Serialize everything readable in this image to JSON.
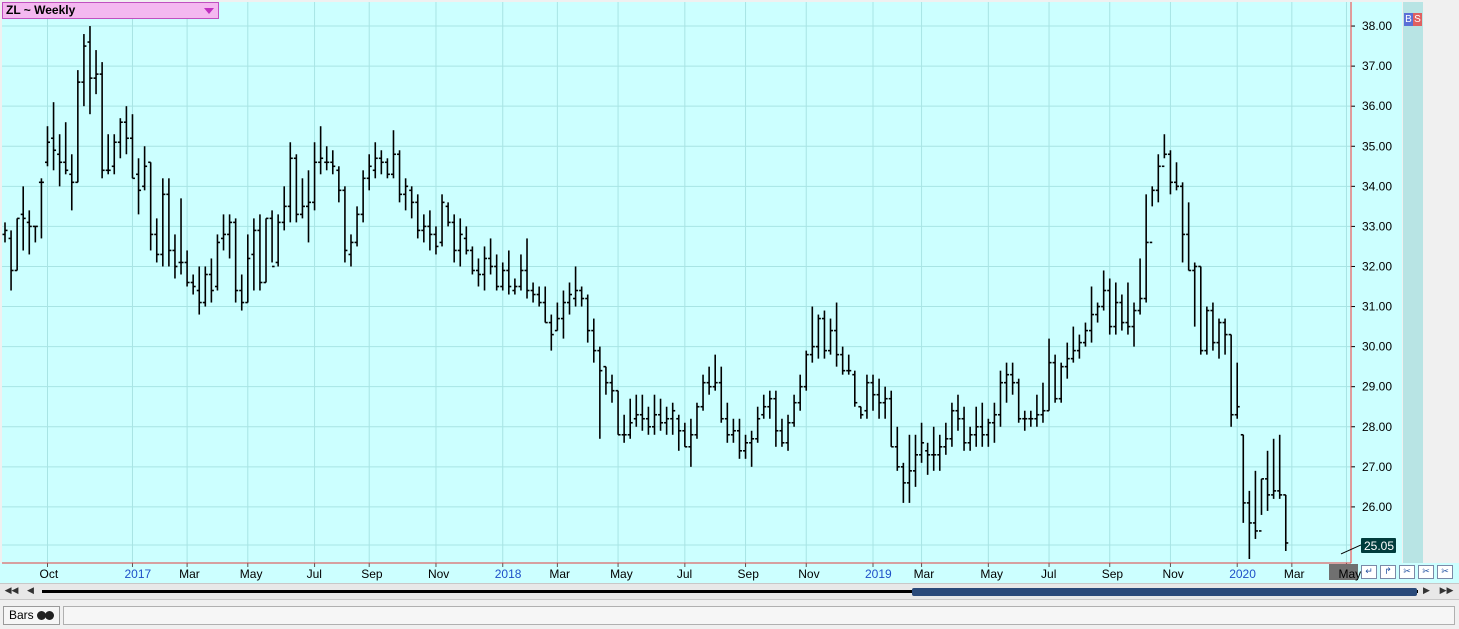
{
  "toolbar": {
    "symbol_label": "ZL ~ Weekly"
  },
  "buy_sell": {
    "buy": "B",
    "sell": "S"
  },
  "bottom": {
    "tab_label": "Bars"
  },
  "colors": {
    "plot_bg": "#ccffff",
    "grid": "#a8e4e4",
    "bar": "#000000",
    "axis_bg": "#ccffff",
    "price_tag": "#003c3c",
    "year_label": "#1e50c8"
  },
  "icons": {
    "scroll_left": "double-left-arrow-icon",
    "scroll_right": "double-right-arrow-icon"
  },
  "chart_data": {
    "type": "ohlc",
    "interval": "Weekly",
    "symbol": "ZL",
    "ylim": [
      24.6,
      38.6
    ],
    "yticks": [
      26.0,
      27.0,
      28.0,
      29.0,
      30.0,
      31.0,
      32.0,
      33.0,
      34.0,
      35.0,
      36.0,
      37.0,
      38.0
    ],
    "last_price": "25.05",
    "x_labels": [
      {
        "label": "Oct",
        "i": 7,
        "year": false
      },
      {
        "label": "2017",
        "i": 21,
        "year": true
      },
      {
        "label": "Mar",
        "i": 30,
        "year": false
      },
      {
        "label": "May",
        "i": 40,
        "year": false
      },
      {
        "label": "Jul",
        "i": 51,
        "year": false
      },
      {
        "label": "Sep",
        "i": 60,
        "year": false
      },
      {
        "label": "Nov",
        "i": 71,
        "year": false
      },
      {
        "label": "2018",
        "i": 82,
        "year": true
      },
      {
        "label": "Mar",
        "i": 91,
        "year": false
      },
      {
        "label": "May",
        "i": 101,
        "year": false
      },
      {
        "label": "Jul",
        "i": 112,
        "year": false
      },
      {
        "label": "Sep",
        "i": 122,
        "year": false
      },
      {
        "label": "Nov",
        "i": 132,
        "year": false
      },
      {
        "label": "2019",
        "i": 143,
        "year": true
      },
      {
        "label": "Mar",
        "i": 151,
        "year": false
      },
      {
        "label": "May",
        "i": 162,
        "year": false
      },
      {
        "label": "Jul",
        "i": 172,
        "year": false
      },
      {
        "label": "Sep",
        "i": 182,
        "year": false
      },
      {
        "label": "Nov",
        "i": 192,
        "year": false
      },
      {
        "label": "2020",
        "i": 203,
        "year": true
      },
      {
        "label": "Mar",
        "i": 212,
        "year": false
      },
      {
        "label": "May",
        "i": 221,
        "year": false
      }
    ],
    "bars": [
      [
        32.8,
        33.1,
        32.6,
        32.9
      ],
      [
        32.7,
        32.9,
        31.4,
        31.9
      ],
      [
        31.9,
        33.2,
        31.9,
        33.2
      ],
      [
        33.3,
        34.0,
        32.4,
        33.2
      ],
      [
        33.1,
        33.4,
        32.3,
        33.0
      ],
      [
        33.0,
        33.0,
        32.6,
        33.0
      ],
      [
        34.1,
        34.2,
        32.7,
        34.1
      ],
      [
        34.6,
        35.5,
        34.5,
        35.1
      ],
      [
        35.2,
        36.1,
        34.4,
        34.9
      ],
      [
        34.8,
        35.3,
        34.0,
        34.6
      ],
      [
        34.6,
        35.6,
        34.3,
        34.4
      ],
      [
        34.3,
        34.8,
        33.4,
        34.1
      ],
      [
        34.1,
        36.9,
        34.1,
        36.6
      ],
      [
        36.6,
        37.8,
        36.0,
        37.5
      ],
      [
        37.6,
        38.0,
        35.8,
        36.7
      ],
      [
        36.7,
        37.4,
        36.3,
        36.8
      ],
      [
        36.8,
        37.1,
        34.2,
        34.4
      ],
      [
        34.4,
        35.3,
        34.3,
        34.4
      ],
      [
        34.5,
        35.3,
        34.3,
        35.1
      ],
      [
        35.1,
        35.7,
        34.7,
        35.6
      ],
      [
        35.6,
        36.0,
        34.8,
        35.2
      ],
      [
        35.2,
        35.8,
        34.2,
        34.2
      ],
      [
        34.3,
        34.7,
        33.3,
        33.9
      ],
      [
        34.0,
        35.0,
        33.9,
        34.5
      ],
      [
        34.6,
        34.6,
        32.4,
        32.8
      ],
      [
        32.8,
        33.2,
        32.1,
        32.3
      ],
      [
        32.3,
        34.2,
        32.0,
        33.8
      ],
      [
        33.8,
        34.2,
        32.0,
        32.4
      ],
      [
        32.4,
        32.8,
        31.7,
        32.0
      ],
      [
        32.1,
        33.7,
        31.8,
        32.1
      ],
      [
        32.1,
        32.4,
        31.5,
        31.6
      ],
      [
        31.6,
        31.8,
        31.3,
        31.5
      ],
      [
        31.4,
        32.0,
        30.8,
        31.1
      ],
      [
        31.1,
        32.0,
        31.0,
        31.8
      ],
      [
        31.8,
        32.2,
        31.1,
        31.4
      ],
      [
        31.5,
        32.8,
        31.4,
        32.6
      ],
      [
        32.7,
        33.3,
        32.4,
        32.8
      ],
      [
        32.8,
        33.3,
        32.2,
        33.1
      ],
      [
        33.1,
        33.2,
        31.1,
        31.4
      ],
      [
        31.4,
        31.8,
        30.9,
        31.1
      ],
      [
        31.1,
        32.8,
        31.1,
        32.2
      ],
      [
        32.3,
        33.2,
        31.4,
        32.9
      ],
      [
        32.9,
        33.3,
        31.4,
        31.6
      ],
      [
        31.6,
        33.2,
        31.6,
        33.2
      ],
      [
        33.2,
        33.4,
        32.1,
        32.0
      ],
      [
        32.1,
        33.3,
        32.0,
        33.1
      ],
      [
        33.1,
        34.0,
        32.9,
        33.5
      ],
      [
        33.5,
        35.1,
        33.1,
        34.7
      ],
      [
        34.7,
        34.8,
        33.1,
        33.3
      ],
      [
        33.3,
        34.2,
        33.2,
        33.5
      ],
      [
        33.5,
        34.4,
        32.6,
        33.6
      ],
      [
        33.6,
        35.1,
        33.4,
        34.6
      ],
      [
        34.6,
        35.5,
        34.3,
        34.7
      ],
      [
        34.6,
        35.0,
        34.4,
        34.6
      ],
      [
        34.6,
        34.9,
        34.3,
        34.5
      ],
      [
        34.4,
        34.5,
        33.6,
        33.9
      ],
      [
        33.9,
        34.0,
        32.1,
        32.4
      ],
      [
        32.3,
        32.8,
        32.0,
        32.6
      ],
      [
        32.6,
        33.5,
        32.5,
        33.3
      ],
      [
        33.3,
        34.4,
        33.1,
        34.2
      ],
      [
        34.2,
        34.8,
        33.9,
        34.5
      ],
      [
        34.4,
        35.1,
        34.2,
        34.7
      ],
      [
        34.7,
        34.9,
        34.3,
        34.6
      ],
      [
        34.6,
        34.7,
        34.2,
        34.3
      ],
      [
        34.3,
        35.4,
        34.2,
        34.8
      ],
      [
        34.8,
        34.9,
        33.6,
        33.8
      ],
      [
        33.8,
        34.2,
        33.4,
        34.0
      ],
      [
        33.9,
        34.0,
        33.2,
        33.6
      ],
      [
        33.6,
        33.8,
        32.7,
        32.9
      ],
      [
        32.9,
        33.3,
        32.6,
        33.0
      ],
      [
        33.0,
        33.4,
        32.4,
        32.8
      ],
      [
        32.8,
        33.0,
        32.3,
        32.5
      ],
      [
        32.6,
        33.8,
        32.5,
        33.6
      ],
      [
        33.5,
        33.6,
        33.0,
        33.1
      ],
      [
        33.1,
        33.3,
        32.1,
        32.4
      ],
      [
        32.4,
        33.2,
        32.0,
        32.8
      ],
      [
        32.7,
        33.0,
        32.3,
        32.4
      ],
      [
        32.4,
        32.5,
        31.8,
        31.9
      ],
      [
        31.9,
        32.2,
        31.5,
        31.8
      ],
      [
        31.8,
        32.5,
        31.4,
        32.2
      ],
      [
        32.2,
        32.7,
        31.8,
        32.0
      ],
      [
        32.0,
        32.3,
        31.4,
        31.5
      ],
      [
        31.5,
        32.1,
        31.4,
        31.9
      ],
      [
        31.9,
        32.4,
        31.3,
        31.5
      ],
      [
        31.4,
        31.7,
        31.3,
        31.5
      ],
      [
        31.5,
        32.3,
        31.4,
        31.9
      ],
      [
        31.9,
        32.7,
        31.2,
        31.4
      ],
      [
        31.4,
        31.6,
        31.1,
        31.3
      ],
      [
        31.3,
        31.5,
        31.0,
        31.1
      ],
      [
        31.1,
        31.5,
        30.6,
        30.6
      ],
      [
        30.6,
        30.8,
        29.9,
        30.3
      ],
      [
        30.4,
        31.1,
        30.4,
        30.7
      ],
      [
        30.7,
        31.4,
        30.2,
        31.1
      ],
      [
        31.1,
        31.6,
        30.8,
        31.3
      ],
      [
        31.2,
        32.0,
        31.0,
        31.4
      ],
      [
        31.4,
        31.5,
        31.0,
        31.2
      ],
      [
        31.2,
        31.3,
        30.1,
        30.4
      ],
      [
        30.4,
        30.7,
        29.6,
        29.9
      ],
      [
        29.9,
        30.0,
        27.7,
        29.4
      ],
      [
        29.5,
        29.5,
        28.8,
        29.1
      ],
      [
        29.1,
        29.3,
        28.6,
        28.9
      ],
      [
        28.9,
        28.9,
        27.8,
        27.8
      ],
      [
        27.8,
        28.3,
        27.6,
        27.8
      ],
      [
        27.8,
        28.7,
        27.7,
        28.1
      ],
      [
        28.2,
        28.8,
        28.0,
        28.3
      ],
      [
        28.3,
        28.8,
        27.9,
        28.2
      ],
      [
        28.2,
        28.5,
        27.8,
        28.0
      ],
      [
        28.0,
        28.8,
        27.8,
        28.3
      ],
      [
        28.3,
        28.7,
        27.9,
        28.1
      ],
      [
        28.1,
        28.5,
        27.8,
        28.2
      ],
      [
        28.2,
        28.6,
        27.8,
        28.4
      ],
      [
        28.2,
        28.3,
        27.4,
        27.9
      ],
      [
        27.9,
        28.1,
        27.5,
        27.5
      ],
      [
        27.5,
        28.2,
        27.0,
        27.8
      ],
      [
        27.8,
        28.6,
        27.7,
        28.5
      ],
      [
        28.5,
        29.3,
        28.4,
        29.1
      ],
      [
        29.1,
        29.5,
        28.8,
        29.0
      ],
      [
        29.0,
        29.8,
        28.9,
        29.1
      ],
      [
        29.1,
        29.5,
        28.1,
        28.2
      ],
      [
        28.2,
        28.6,
        27.6,
        27.8
      ],
      [
        27.8,
        28.2,
        27.6,
        27.9
      ],
      [
        27.9,
        28.2,
        27.2,
        27.4
      ],
      [
        27.4,
        27.8,
        27.2,
        27.6
      ],
      [
        27.6,
        27.9,
        27.0,
        27.7
      ],
      [
        27.7,
        28.5,
        27.6,
        28.2
      ],
      [
        28.3,
        28.8,
        28.2,
        28.5
      ],
      [
        28.5,
        28.9,
        28.2,
        28.7
      ],
      [
        28.7,
        28.9,
        27.5,
        27.9
      ],
      [
        27.9,
        28.2,
        27.5,
        27.6
      ],
      [
        27.6,
        28.3,
        27.4,
        28.1
      ],
      [
        28.1,
        28.8,
        28.0,
        28.6
      ],
      [
        28.6,
        29.3,
        28.4,
        29.0
      ],
      [
        29.0,
        29.9,
        28.9,
        29.8
      ],
      [
        29.8,
        31.0,
        29.6,
        30.0
      ],
      [
        30.0,
        30.8,
        29.7,
        30.7
      ],
      [
        30.7,
        30.9,
        29.7,
        29.9
      ],
      [
        29.9,
        30.7,
        29.8,
        30.4
      ],
      [
        30.4,
        31.1,
        29.5,
        29.8
      ],
      [
        29.8,
        30.0,
        29.3,
        29.4
      ],
      [
        29.4,
        29.8,
        29.3,
        29.4
      ],
      [
        29.3,
        29.4,
        28.5,
        28.6
      ],
      [
        28.5,
        28.5,
        28.2,
        28.3
      ],
      [
        28.4,
        29.3,
        28.2,
        29.1
      ],
      [
        29.1,
        29.3,
        28.4,
        28.8
      ],
      [
        28.8,
        29.2,
        28.2,
        28.6
      ],
      [
        28.6,
        29.0,
        28.2,
        28.7
      ],
      [
        28.7,
        28.9,
        27.5,
        27.5
      ],
      [
        27.5,
        28.0,
        26.9,
        27.0
      ],
      [
        27.0,
        27.1,
        26.1,
        26.6
      ],
      [
        26.6,
        27.8,
        26.1,
        26.9
      ],
      [
        26.9,
        27.8,
        26.5,
        27.3
      ],
      [
        27.3,
        28.1,
        27.1,
        27.6
      ],
      [
        27.4,
        27.6,
        26.8,
        27.3
      ],
      [
        27.3,
        28.0,
        26.9,
        27.3
      ],
      [
        27.3,
        27.8,
        26.9,
        27.5
      ],
      [
        27.5,
        28.1,
        27.3,
        27.7
      ],
      [
        27.7,
        28.6,
        27.5,
        28.4
      ],
      [
        28.4,
        28.8,
        27.9,
        28.2
      ],
      [
        28.2,
        28.5,
        27.4,
        27.6
      ],
      [
        27.6,
        28.0,
        27.4,
        27.8
      ],
      [
        27.8,
        28.5,
        27.5,
        28.0
      ],
      [
        28.0,
        28.6,
        27.5,
        27.8
      ],
      [
        27.8,
        28.2,
        27.5,
        28.1
      ],
      [
        28.1,
        28.6,
        27.6,
        28.3
      ],
      [
        28.3,
        29.4,
        28.0,
        29.1
      ],
      [
        29.1,
        29.6,
        28.6,
        29.3
      ],
      [
        29.3,
        29.6,
        28.8,
        29.1
      ],
      [
        29.1,
        29.2,
        28.1,
        28.2
      ],
      [
        28.2,
        28.4,
        27.9,
        28.2
      ],
      [
        28.2,
        28.4,
        28.0,
        28.2
      ],
      [
        28.2,
        28.8,
        28.0,
        28.3
      ],
      [
        28.3,
        29.1,
        28.1,
        28.4
      ],
      [
        28.4,
        30.2,
        28.4,
        29.6
      ],
      [
        29.6,
        29.8,
        28.6,
        28.7
      ],
      [
        28.7,
        29.6,
        28.6,
        29.5
      ],
      [
        29.5,
        30.1,
        29.2,
        29.7
      ],
      [
        29.7,
        30.5,
        29.6,
        29.9
      ],
      [
        29.9,
        30.3,
        29.7,
        30.1
      ],
      [
        30.1,
        30.6,
        30.0,
        30.4
      ],
      [
        30.4,
        31.5,
        30.1,
        30.8
      ],
      [
        30.8,
        31.1,
        30.6,
        31.0
      ],
      [
        31.0,
        31.9,
        30.9,
        31.4
      ],
      [
        31.4,
        31.7,
        30.3,
        30.5
      ],
      [
        30.5,
        31.6,
        30.3,
        31.1
      ],
      [
        31.1,
        31.3,
        30.4,
        30.6
      ],
      [
        30.6,
        31.6,
        30.3,
        30.5
      ],
      [
        30.5,
        31.1,
        30.0,
        30.9
      ],
      [
        30.9,
        32.2,
        30.8,
        31.2
      ],
      [
        31.2,
        33.8,
        31.1,
        32.6
      ],
      [
        32.6,
        34.0,
        33.5,
        33.9
      ],
      [
        33.9,
        34.8,
        33.6,
        34.5
      ],
      [
        34.5,
        35.3,
        34.7,
        34.8
      ],
      [
        34.8,
        34.9,
        33.8,
        34.1
      ],
      [
        34.1,
        34.6,
        33.9,
        34.0
      ],
      [
        34.0,
        34.1,
        32.1,
        32.8
      ],
      [
        32.8,
        33.6,
        31.9,
        31.9
      ],
      [
        31.9,
        32.1,
        30.5,
        32.0
      ],
      [
        32.0,
        32.0,
        29.8,
        29.9
      ],
      [
        29.9,
        31.0,
        29.8,
        30.9
      ],
      [
        30.9,
        31.1,
        29.9,
        30.1
      ],
      [
        30.1,
        30.7,
        29.7,
        30.6
      ],
      [
        30.6,
        30.7,
        29.8,
        30.3
      ],
      [
        30.3,
        30.3,
        28.0,
        28.3
      ],
      [
        28.3,
        29.6,
        28.2,
        28.5
      ],
      [
        27.8,
        27.8,
        25.6,
        26.1
      ],
      [
        26.1,
        26.4,
        24.7,
        25.6
      ],
      [
        25.6,
        26.9,
        25.2,
        25.4
      ],
      [
        25.4,
        26.7,
        25.8,
        26.7
      ],
      [
        26.7,
        27.4,
        25.9,
        26.3
      ],
      [
        26.3,
        27.7,
        26.2,
        26.4
      ],
      [
        26.4,
        27.8,
        26.2,
        26.3
      ],
      [
        26.3,
        26.3,
        24.9,
        25.1
      ]
    ]
  }
}
